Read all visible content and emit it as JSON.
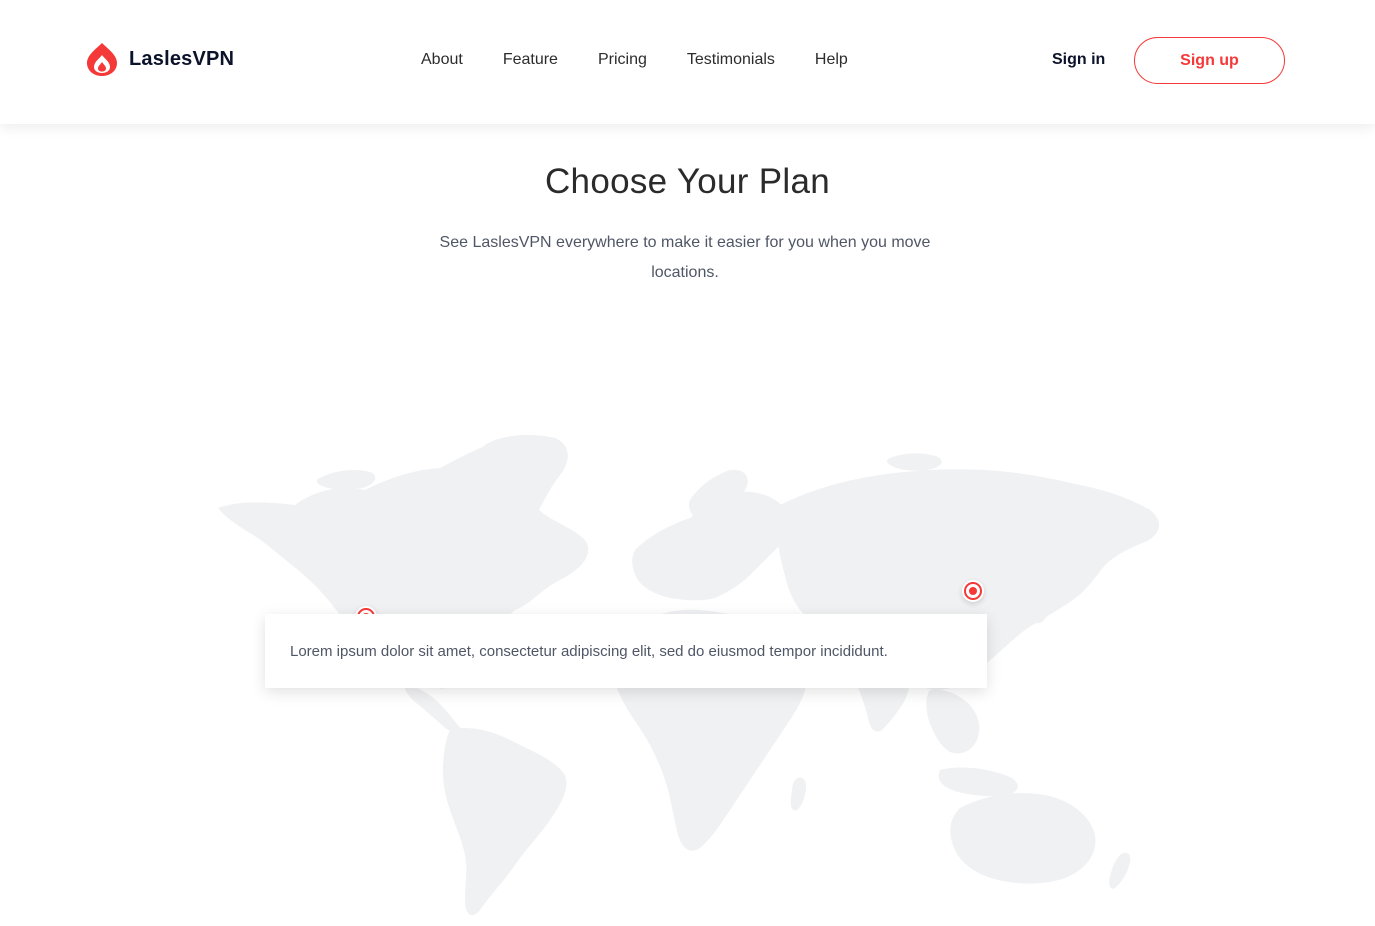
{
  "brand": {
    "name_prefix": "Lasles",
    "name_suffix": "VPN",
    "accent_color": "#F53838"
  },
  "nav": {
    "items": [
      {
        "label": "About"
      },
      {
        "label": "Feature"
      },
      {
        "label": "Pricing"
      },
      {
        "label": "Testimonials"
      },
      {
        "label": "Help"
      }
    ]
  },
  "auth": {
    "sign_in_label": "Sign in",
    "sign_up_label": "Sign up"
  },
  "section": {
    "title": "Choose Your Plan",
    "subtitle": "See LaslesVPN everywhere to make it easier for you when you move locations."
  },
  "map": {
    "tooltip_text": "Lorem ipsum dolor sit amet, consectetur adipiscing elit, sed do eiusmod tempor incididunt.",
    "pins": [
      {
        "name": "location-pin-asia",
        "icon": "location-pin-icon"
      },
      {
        "name": "location-pin-north-america",
        "icon": "location-pin-icon"
      }
    ],
    "land_color": "#F0F1F3"
  }
}
